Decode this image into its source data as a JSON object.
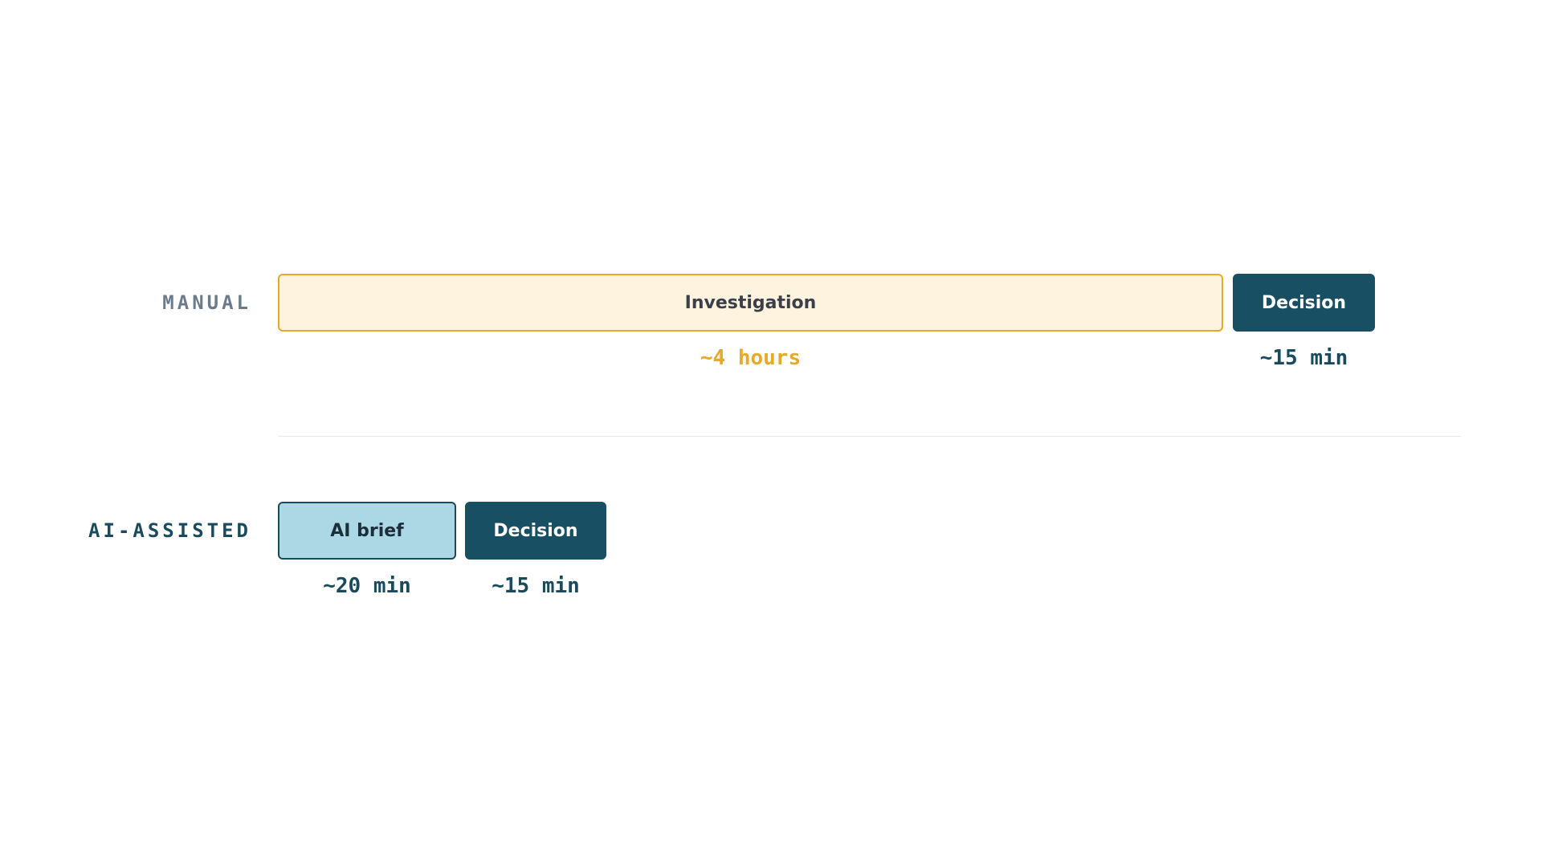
{
  "rows": {
    "manual": {
      "label": "MANUAL",
      "steps": [
        {
          "label": "Investigation",
          "duration": "~4 hours"
        },
        {
          "label": "Decision",
          "duration": "~15 min"
        }
      ]
    },
    "ai_assisted": {
      "label": "AI-ASSISTED",
      "steps": [
        {
          "label": "AI brief",
          "duration": "~20 min"
        },
        {
          "label": "Decision",
          "duration": "~15 min"
        }
      ]
    }
  },
  "colors": {
    "investigation_fill": "#fdf3df",
    "investigation_accent": "#e6a92a",
    "decision_fill": "#184f62",
    "ai_brief_fill": "#acd7e5",
    "dark_text": "#1a4a5e",
    "muted_label": "#6b7b8c"
  }
}
